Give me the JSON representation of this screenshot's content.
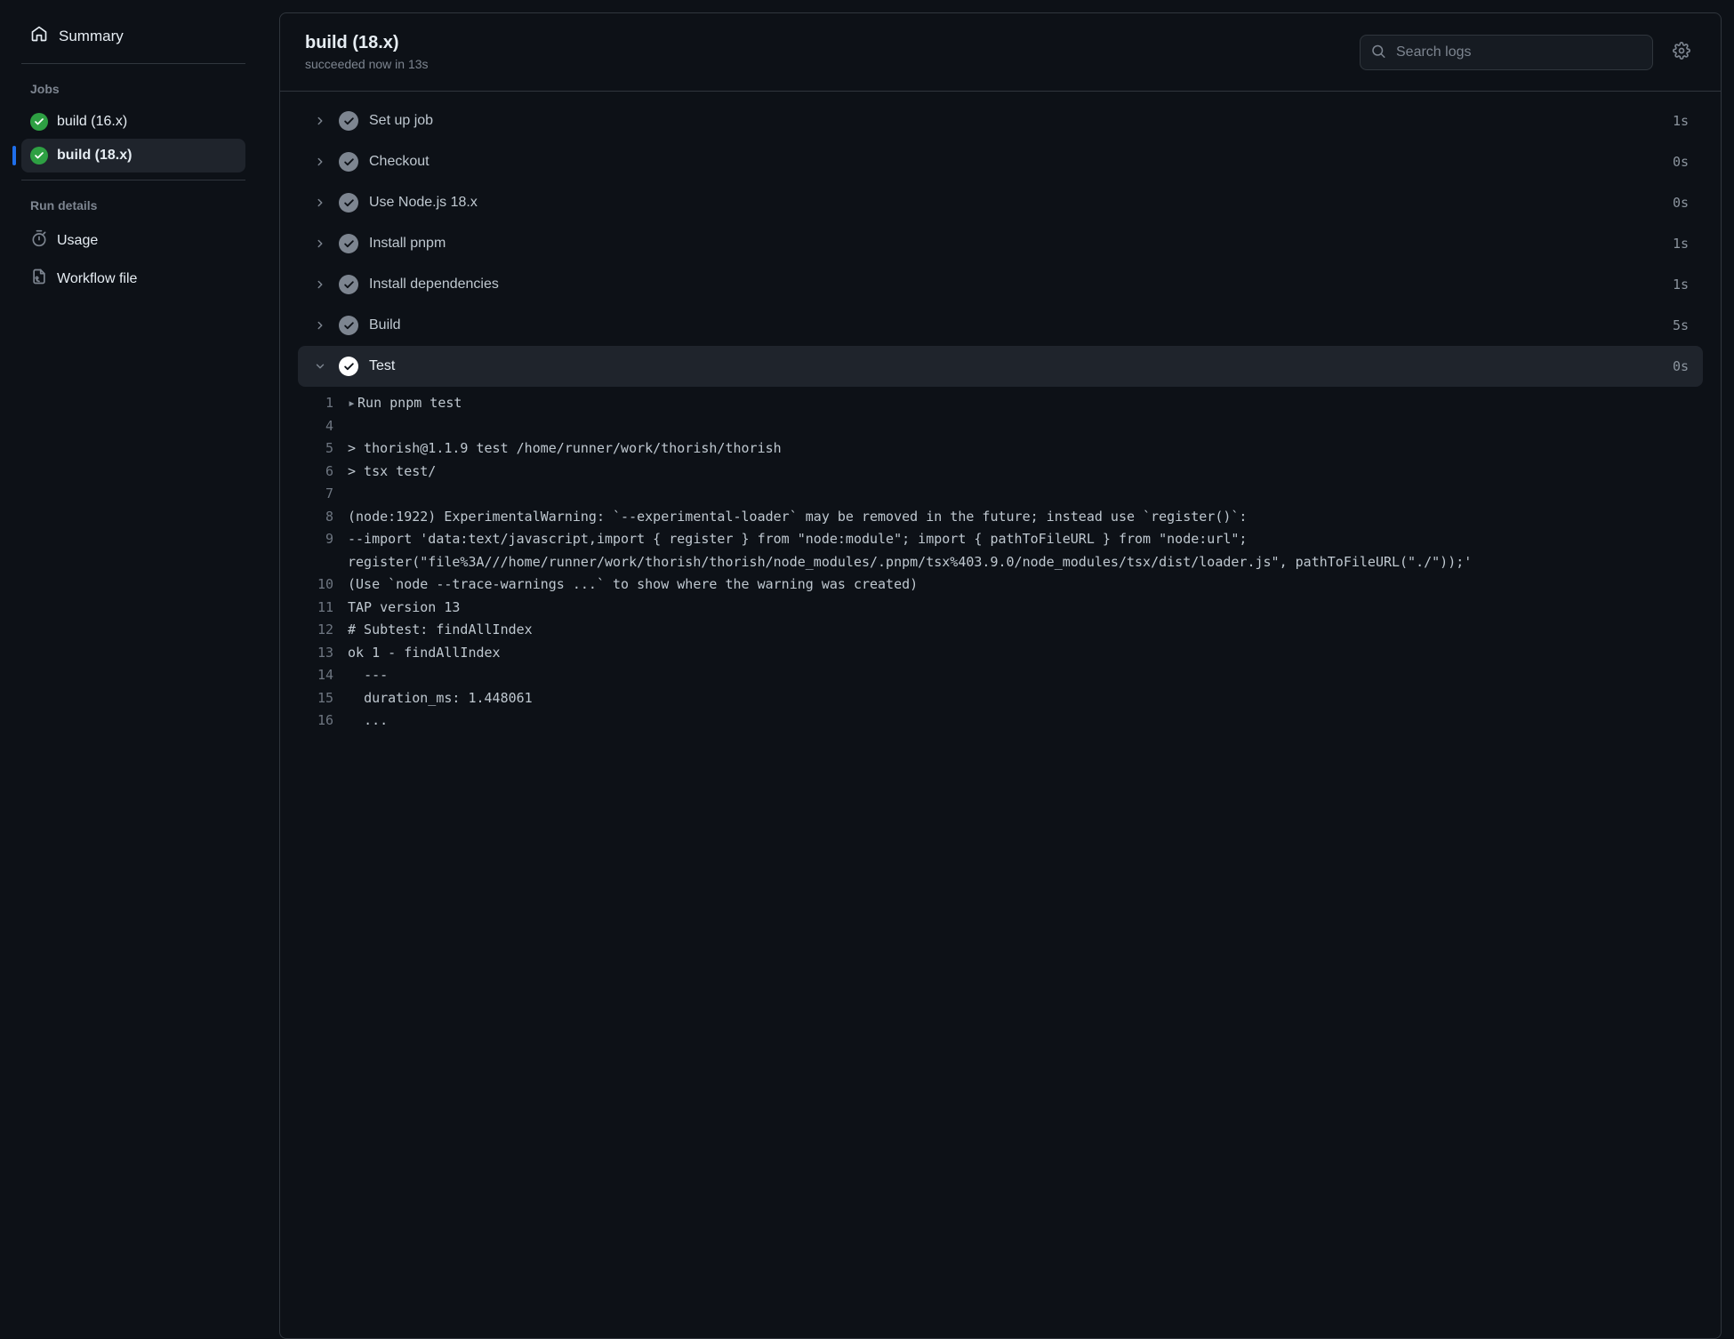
{
  "sidebar": {
    "summary_label": "Summary",
    "jobs_heading": "Jobs",
    "jobs": [
      {
        "label": "build (16.x)",
        "selected": false
      },
      {
        "label": "build (18.x)",
        "selected": true
      }
    ],
    "details_heading": "Run details",
    "details": [
      {
        "label": "Usage",
        "icon": "stopwatch"
      },
      {
        "label": "Workflow file",
        "icon": "workflow-file"
      }
    ]
  },
  "header": {
    "title": "build (18.x)",
    "subtitle": "succeeded now in 13s",
    "search_placeholder": "Search logs"
  },
  "steps": [
    {
      "name": "Set up job",
      "time": "1s",
      "expanded": false
    },
    {
      "name": "Checkout",
      "time": "0s",
      "expanded": false
    },
    {
      "name": "Use Node.js 18.x",
      "time": "0s",
      "expanded": false
    },
    {
      "name": "Install pnpm",
      "time": "1s",
      "expanded": false
    },
    {
      "name": "Install dependencies",
      "time": "1s",
      "expanded": false
    },
    {
      "name": "Build",
      "time": "5s",
      "expanded": false
    },
    {
      "name": "Test",
      "time": "0s",
      "expanded": true
    }
  ],
  "log": [
    {
      "n": "1",
      "t": "Run pnpm test",
      "caret": true
    },
    {
      "n": "4",
      "t": ""
    },
    {
      "n": "5",
      "t": "> thorish@1.1.9 test /home/runner/work/thorish/thorish"
    },
    {
      "n": "6",
      "t": "> tsx test/"
    },
    {
      "n": "7",
      "t": ""
    },
    {
      "n": "8",
      "t": "(node:1922) ExperimentalWarning: `--experimental-loader` may be removed in the future; instead use `register()`:"
    },
    {
      "n": "9",
      "t": "--import 'data:text/javascript,import { register } from \"node:module\"; import { pathToFileURL } from \"node:url\"; register(\"file%3A///home/runner/work/thorish/thorish/node_modules/.pnpm/tsx%403.9.0/node_modules/tsx/dist/loader.js\", pathToFileURL(\"./\"));'"
    },
    {
      "n": "10",
      "t": "(Use `node --trace-warnings ...` to show where the warning was created)"
    },
    {
      "n": "11",
      "t": "TAP version 13"
    },
    {
      "n": "12",
      "t": "# Subtest: findAllIndex"
    },
    {
      "n": "13",
      "t": "ok 1 - findAllIndex"
    },
    {
      "n": "14",
      "t": "  ---"
    },
    {
      "n": "15",
      "t": "  duration_ms: 1.448061"
    },
    {
      "n": "16",
      "t": "  ..."
    }
  ]
}
